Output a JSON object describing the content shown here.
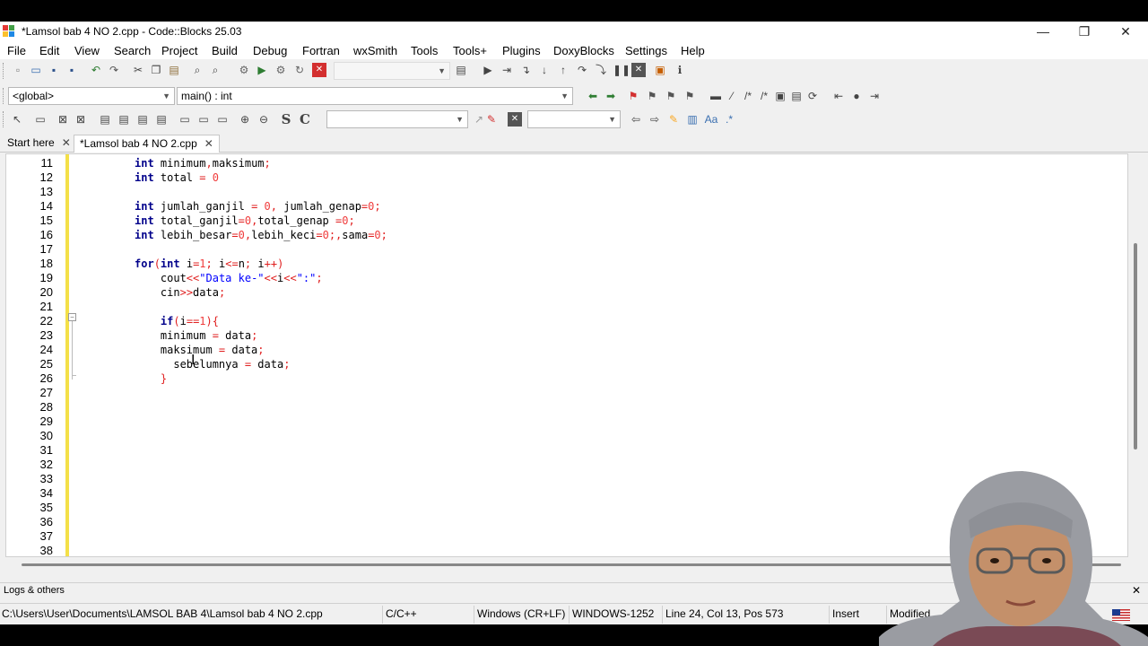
{
  "window": {
    "title": "*Lamsol bab 4 NO 2.cpp - Code::Blocks 25.03",
    "minimize": "—",
    "maximize": "❐",
    "close": "✕"
  },
  "menu": [
    "File",
    "Edit",
    "View",
    "Search",
    "Project",
    "Build",
    "Debug",
    "Fortran",
    "wxSmith",
    "Tools",
    "Tools+",
    "Plugins",
    "DoxyBlocks",
    "Settings",
    "Help"
  ],
  "scope_bar": {
    "scope_value": "<global>",
    "function_value": "main() : int"
  },
  "tabs": [
    {
      "label": "Start here",
      "close": "✕"
    },
    {
      "label": "*Lamsol bab 4 NO 2.cpp",
      "close": "✕"
    }
  ],
  "editor": {
    "lines": [
      {
        "n": "11",
        "code": "int minimum,maksimum;"
      },
      {
        "n": "12",
        "code": "int total = 0"
      },
      {
        "n": "13",
        "code": ""
      },
      {
        "n": "14",
        "code": "int jumlah_ganjil = 0, jumlah_genap=0;"
      },
      {
        "n": "15",
        "code": "int total_ganjil=0,total_genap =0;"
      },
      {
        "n": "16",
        "code": "int lebih_besar=0,lebih_keci=0;,sama=0;"
      },
      {
        "n": "17",
        "code": ""
      },
      {
        "n": "18",
        "code": "for(int i=1; i<=n; i++)"
      },
      {
        "n": "19",
        "code": "    cout<<\"Data ke-\"<<i<<\":\";"
      },
      {
        "n": "20",
        "code": "    cin>>data;"
      },
      {
        "n": "21",
        "code": ""
      },
      {
        "n": "22",
        "code": "    if(i==1){"
      },
      {
        "n": "23",
        "code": "    minimum = data;"
      },
      {
        "n": "24",
        "code": "    maksimum = data;"
      },
      {
        "n": "25",
        "code": "      sebelumnya = data;"
      },
      {
        "n": "26",
        "code": "    }"
      },
      {
        "n": "27",
        "code": ""
      },
      {
        "n": "28",
        "code": ""
      },
      {
        "n": "29",
        "code": ""
      },
      {
        "n": "30",
        "code": ""
      },
      {
        "n": "31",
        "code": ""
      },
      {
        "n": "32",
        "code": ""
      },
      {
        "n": "33",
        "code": ""
      },
      {
        "n": "34",
        "code": ""
      },
      {
        "n": "35",
        "code": ""
      },
      {
        "n": "36",
        "code": ""
      },
      {
        "n": "37",
        "code": ""
      },
      {
        "n": "38",
        "code": ""
      }
    ]
  },
  "logs": {
    "label": "Logs & others",
    "close": "✕"
  },
  "status": {
    "path": "C:\\Users\\User\\Documents\\LAMSOL BAB 4\\Lamsol bab 4 NO 2.cpp",
    "language": "C/C++",
    "line_endings": "Windows (CR+LF)",
    "encoding": "WINDOWS-1252",
    "position": "Line 24, Col 13, Pos 573",
    "mode": "Insert",
    "modified": "Modified"
  },
  "colors": {
    "keyword": "#00008b",
    "number": "#f03c3c",
    "string": "#0000ff",
    "changebar": "#f4e048"
  }
}
